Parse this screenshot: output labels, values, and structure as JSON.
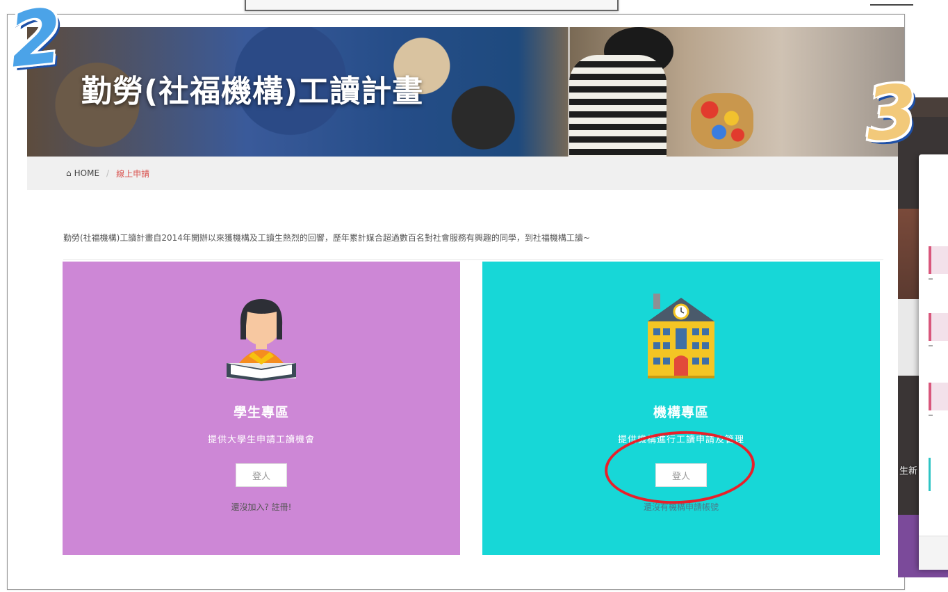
{
  "steps": {
    "badge_2": "2",
    "badge_3": "3"
  },
  "banner": {
    "title": "勤勞(社福機構)工讀計畫"
  },
  "breadcrumb": {
    "home": "HOME",
    "current": "線上申請"
  },
  "intro": "勤勞(社福機構)工讀計畫自2014年開辦以來獲機構及工讀生熱烈的回響，歷年累計媒合超過數百名對社會服務有興趣的同學，到社福機構工讀~",
  "cards": {
    "student": {
      "title": "學生專區",
      "desc": "提供大學生申請工讀機會",
      "login": "登人",
      "link": "還沒加入? 註冊!",
      "color": "#cd87d6",
      "icon": "student-reading-icon"
    },
    "org": {
      "title": "機構專區",
      "desc": "提供機構進行工讀申請及管理",
      "login": "登人",
      "link": "還沒有機構申請帳號",
      "color": "#17d7d7",
      "icon": "school-building-icon"
    }
  },
  "side_text": "生新",
  "annotation": {
    "color": "#e8202a"
  }
}
